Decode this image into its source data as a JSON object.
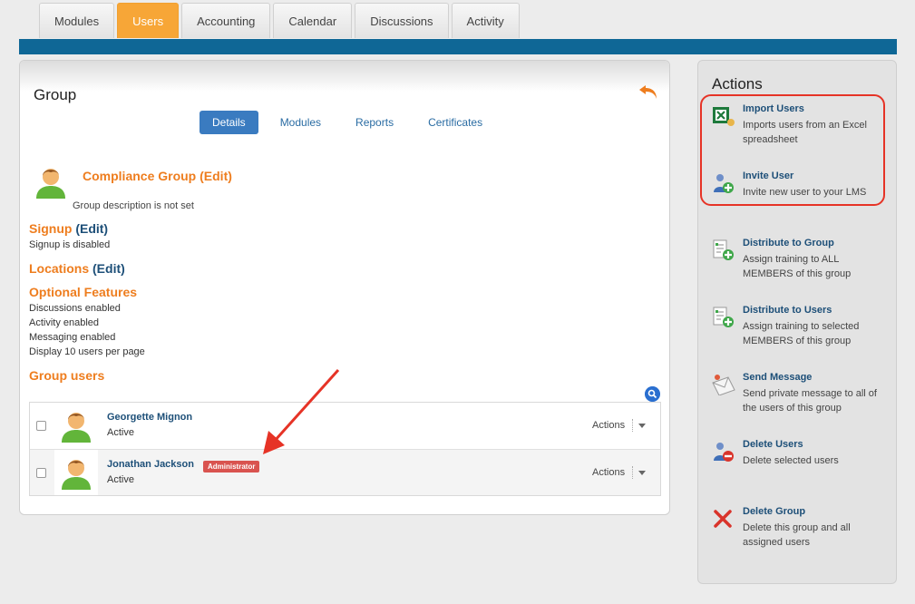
{
  "tabs": [
    {
      "label": "Modules",
      "active": false
    },
    {
      "label": "Users",
      "active": true
    },
    {
      "label": "Accounting",
      "active": false
    },
    {
      "label": "Calendar",
      "active": false
    },
    {
      "label": "Discussions",
      "active": false
    },
    {
      "label": "Activity",
      "active": false
    }
  ],
  "panel": {
    "title": "Group",
    "subtabs": [
      "Details",
      "Modules",
      "Reports",
      "Certificates"
    ],
    "group_name": "Compliance Group",
    "edit_label": "(Edit)",
    "group_description": "Group description is not set",
    "signup": {
      "heading": "Signup",
      "edit": "(Edit)",
      "text": "Signup is disabled"
    },
    "locations": {
      "heading": "Locations",
      "edit": "(Edit)"
    },
    "optional": {
      "heading": "Optional Features",
      "lines": [
        "Discussions enabled",
        "Activity enabled",
        "Messaging enabled",
        "Display 10 users per page"
      ]
    },
    "group_users_heading": "Group users",
    "users": [
      {
        "name": "Georgette Mignon",
        "status": "Active",
        "badge": "",
        "actions": "Actions"
      },
      {
        "name": "Jonathan Jackson",
        "status": "Active",
        "badge": "Administrator",
        "actions": "Actions"
      }
    ]
  },
  "sidebar": {
    "title": "Actions",
    "items": [
      {
        "title": "Import Users",
        "desc": "Imports users from an Excel spreadsheet",
        "icon": "excel-import-icon"
      },
      {
        "title": "Invite User",
        "desc": "Invite new user to your LMS",
        "icon": "invite-user-icon"
      },
      {
        "title": "Distribute to Group",
        "desc": "Assign training to ALL MEMBERS of this group",
        "icon": "distribute-group-icon"
      },
      {
        "title": "Distribute to Users",
        "desc": "Assign training to selected MEMBERS of this group",
        "icon": "distribute-users-icon"
      },
      {
        "title": "Send Message",
        "desc": "Send private message to all of the users of this group",
        "icon": "message-icon"
      },
      {
        "title": "Delete Users",
        "desc": "Delete selected users",
        "icon": "delete-users-icon"
      },
      {
        "title": "Delete Group",
        "desc": "Delete this group and all assigned users",
        "icon": "delete-x-icon"
      }
    ]
  },
  "colors": {
    "accent": "#f7a637",
    "brand_bar": "#0f6796",
    "heading_orange": "#ee7d1e",
    "link": "#1d4f78",
    "annotation": "#e63326"
  }
}
